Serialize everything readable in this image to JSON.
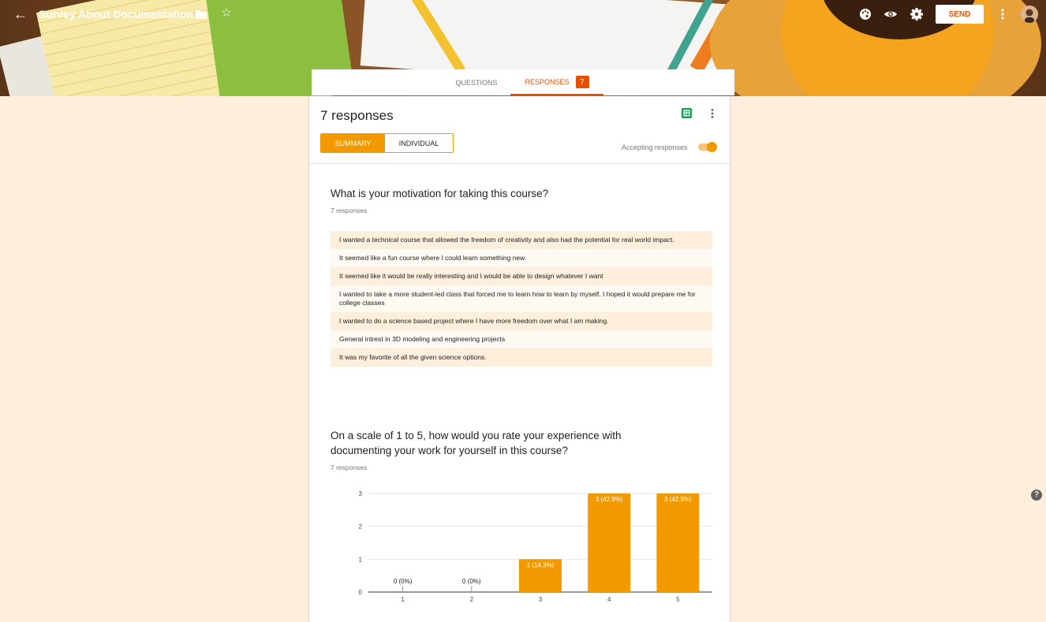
{
  "header": {
    "title": "Survey About Documentation",
    "send_label": "SEND",
    "icons": [
      "back-arrow-icon",
      "folder-icon",
      "star-icon",
      "palette-icon",
      "eye-icon",
      "gear-icon",
      "more-vert-icon"
    ]
  },
  "tabs": {
    "questions": "QUESTIONS",
    "responses": "RESPONSES",
    "responses_count": "7"
  },
  "summary": {
    "title": "7 responses",
    "view_summary": "SUMMARY",
    "view_individual": "INDIVIDUAL",
    "accepting_label": "Accepting responses",
    "accepting": true
  },
  "questions": [
    {
      "title": "What is your motivation for taking this course?",
      "count": "7 responses",
      "answers": [
        "I wanted a technical course that allowed the freedom of creativity and also had the potential for real world impact.",
        "It seemed like a fun course where I could learn something new.",
        "It seemed like it would be really interesting and I would be able to design whatever I want",
        "I wanted to take a more student-led class that forced me to learn how to learn by myself. I hoped it would prepare me for college classes",
        "I wanted to do a science based project where I have more freedom over what I am making.",
        "General intrest in 3D modeling and engineering projects",
        "It was my favorite of all the given science options."
      ]
    },
    {
      "title": "On a scale of 1 to 5, how would you rate your experience with documenting your work for yourself in this course?",
      "count": "7 responses"
    }
  ],
  "colors": {
    "accent": "#e65100",
    "bar": "#f29900",
    "background": "#fdefdc"
  },
  "chart_data": {
    "type": "bar",
    "categories": [
      "1",
      "2",
      "3",
      "4",
      "5"
    ],
    "values": [
      0,
      0,
      1,
      3,
      3
    ],
    "data_labels": [
      "0 (0%)",
      "0 (0%)",
      "1 (14.3%)",
      "3 (42.9%)",
      "3 (42.9%)"
    ],
    "y_ticks": [
      "0",
      "1",
      "2",
      "3"
    ],
    "ylim": [
      0,
      3
    ],
    "grid": true
  }
}
